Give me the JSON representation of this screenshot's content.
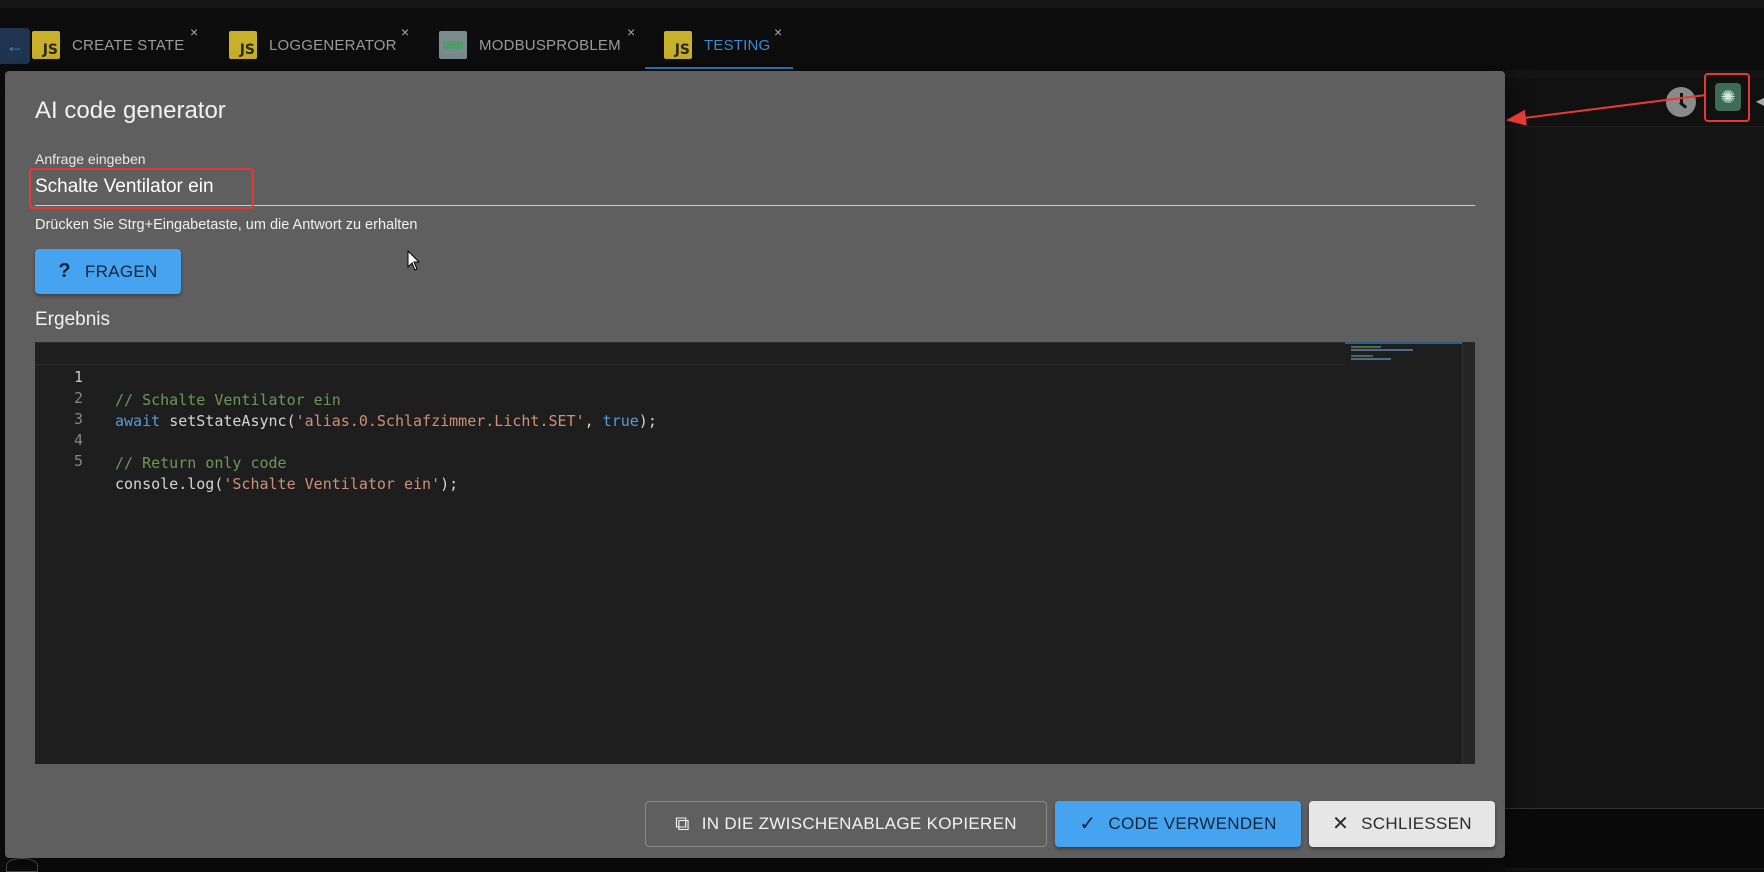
{
  "tabs": [
    {
      "label": "CREATE STATE",
      "icon": "js-icon",
      "active": false
    },
    {
      "label": "LOGGENERATOR",
      "icon": "js-icon",
      "active": false
    },
    {
      "label": "MODBUSPROBLEM",
      "icon": "blockly-icon",
      "active": false
    },
    {
      "label": "TESTING",
      "icon": "js-icon",
      "active": true
    }
  ],
  "tab_icon_text": "JS",
  "tab_close_glyph": "×",
  "dialog": {
    "title": "AI code generator",
    "query_label": "Anfrage eingeben",
    "query_value": "Schalte Ventilator ein",
    "helper_text": "Drücken Sie Strg+Eingabetaste, um die Antwort zu erhalten",
    "ask_button": "FRAGEN",
    "result_label": "Ergebnis"
  },
  "code_lines": [
    {
      "number": "1",
      "text": "// Schalte Ventilator ein"
    },
    {
      "number": "2",
      "text": "await setStateAsync('alias.0.Schlafzimmer.Licht.SET', true);"
    },
    {
      "number": "3",
      "text": ""
    },
    {
      "number": "4",
      "text": "// Return only code"
    },
    {
      "number": "5",
      "text": "console.log('Schalte Ventilator ein');"
    }
  ],
  "footer": {
    "copy_button": "IN DIE ZWISCHENABLAGE KOPIEREN",
    "use_button": "CODE VERWENDEN",
    "close_button": "SCHLIESSEN"
  },
  "colors": {
    "accent_blue": "#46a3ef",
    "annotation_red": "#e53935",
    "dialog_bg": "#5f5f5f",
    "editor_bg": "#1e1e1e"
  },
  "icons": [
    "back-arrow-icon",
    "js-icon",
    "blockly-icon",
    "close-icon",
    "clock-icon",
    "openai-icon",
    "question-icon",
    "copy-icon",
    "check-icon",
    "close-icon"
  ]
}
